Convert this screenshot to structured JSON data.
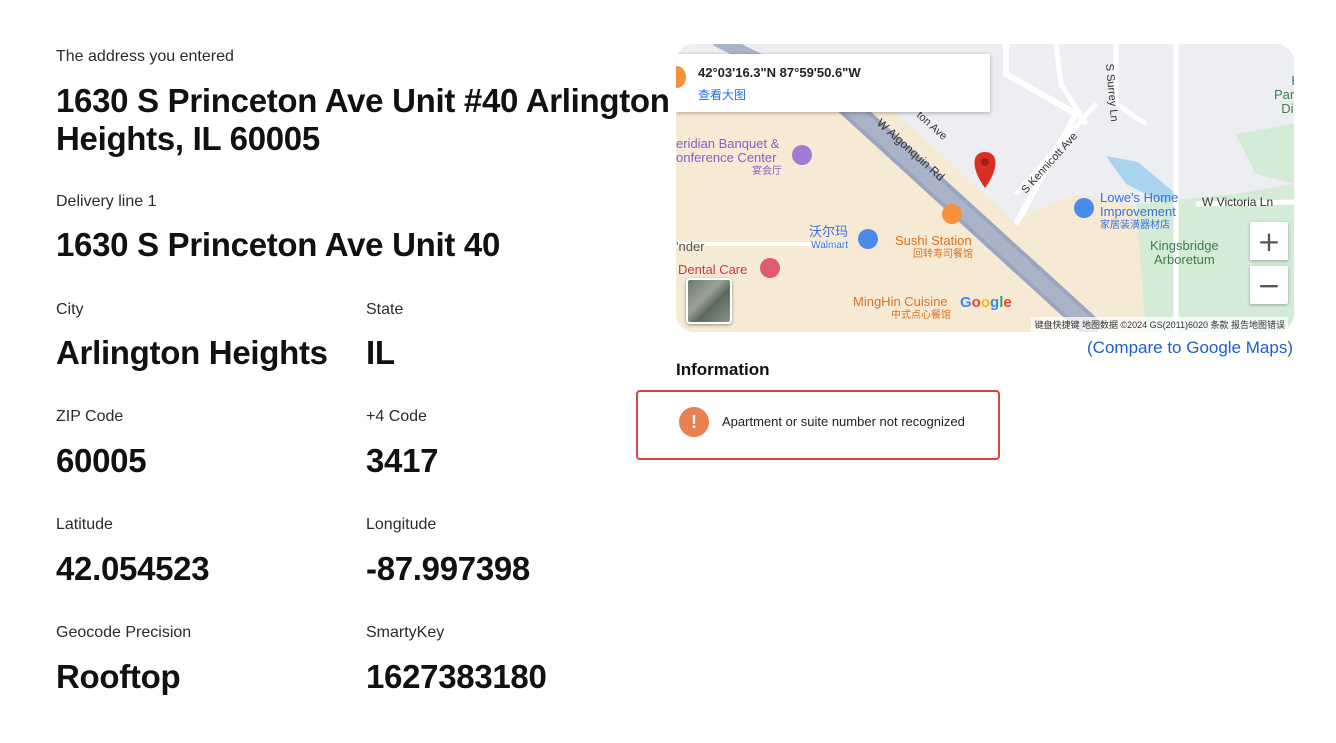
{
  "address": {
    "label": "The address you entered",
    "value": "1630 S Princeton Ave Unit #40 Arlington Heights, IL 60005"
  },
  "delivery": {
    "label": "Delivery line 1",
    "value": "1630 S Princeton Ave Unit 40"
  },
  "city": {
    "label": "City",
    "value": "Arlington Heights"
  },
  "state": {
    "label": "State",
    "value": "IL"
  },
  "zip": {
    "label": "ZIP Code",
    "value": "60005"
  },
  "plus4": {
    "label": "+4 Code",
    "value": "3417"
  },
  "latitude": {
    "label": "Latitude",
    "value": "42.054523"
  },
  "longitude": {
    "label": "Longitude",
    "value": "-87.997398"
  },
  "precision": {
    "label": "Geocode Precision",
    "value": "Rooftop"
  },
  "smartykey": {
    "label": "SmartyKey",
    "value": "1627383180"
  },
  "map": {
    "coords": "42°03'16.3\"N 87°59'50.6\"W",
    "view_larger": "查看大图",
    "places": {
      "banquet": "eridian Banquet &",
      "banquet2": "onference Center",
      "banquet_cn": "宴会厅",
      "walmart_cn": "沃尔玛",
      "walmart": "Walmart",
      "sushi": "Sushi Station",
      "sushi_cn": "回转寿司餐馆",
      "dental": "Dental Care",
      "minghin": "MingHin Cuisine",
      "minghin_cn": "中式点心餐馆",
      "lowes": "Lowe's Home",
      "lowes2": "Improvement",
      "lowes_cn": "家居装潢器材店",
      "kingsbridge": "Kingsbridge",
      "arboretum": "Arboretum",
      "h_park": "H",
      "h_park2": "Park",
      "h_park3": "Dia",
      "nder": "'nder"
    },
    "streets": {
      "algonquin": "W Algonquin Rd",
      "princeton": "ton Ave",
      "kennicott": "S Kennicott Ave",
      "surrey": "S Surrey Ln",
      "victoria": "W Victoria Ln"
    },
    "zoom_in": "+",
    "zoom_out": "−",
    "google": "Google",
    "attribution": "键盘快捷键   地图数据 ©2024 GS(2011)6020   条款   报告地图错误",
    "compare": "(Compare to Google Maps)"
  },
  "information": {
    "title": "Information",
    "alert": "Apartment or suite number not recognized",
    "alert_icon": "!"
  },
  "colors": {
    "alert_border": "#d64541",
    "alert_icon": "#e8804f",
    "link": "#1a5fd1",
    "pin": "#d93025"
  }
}
